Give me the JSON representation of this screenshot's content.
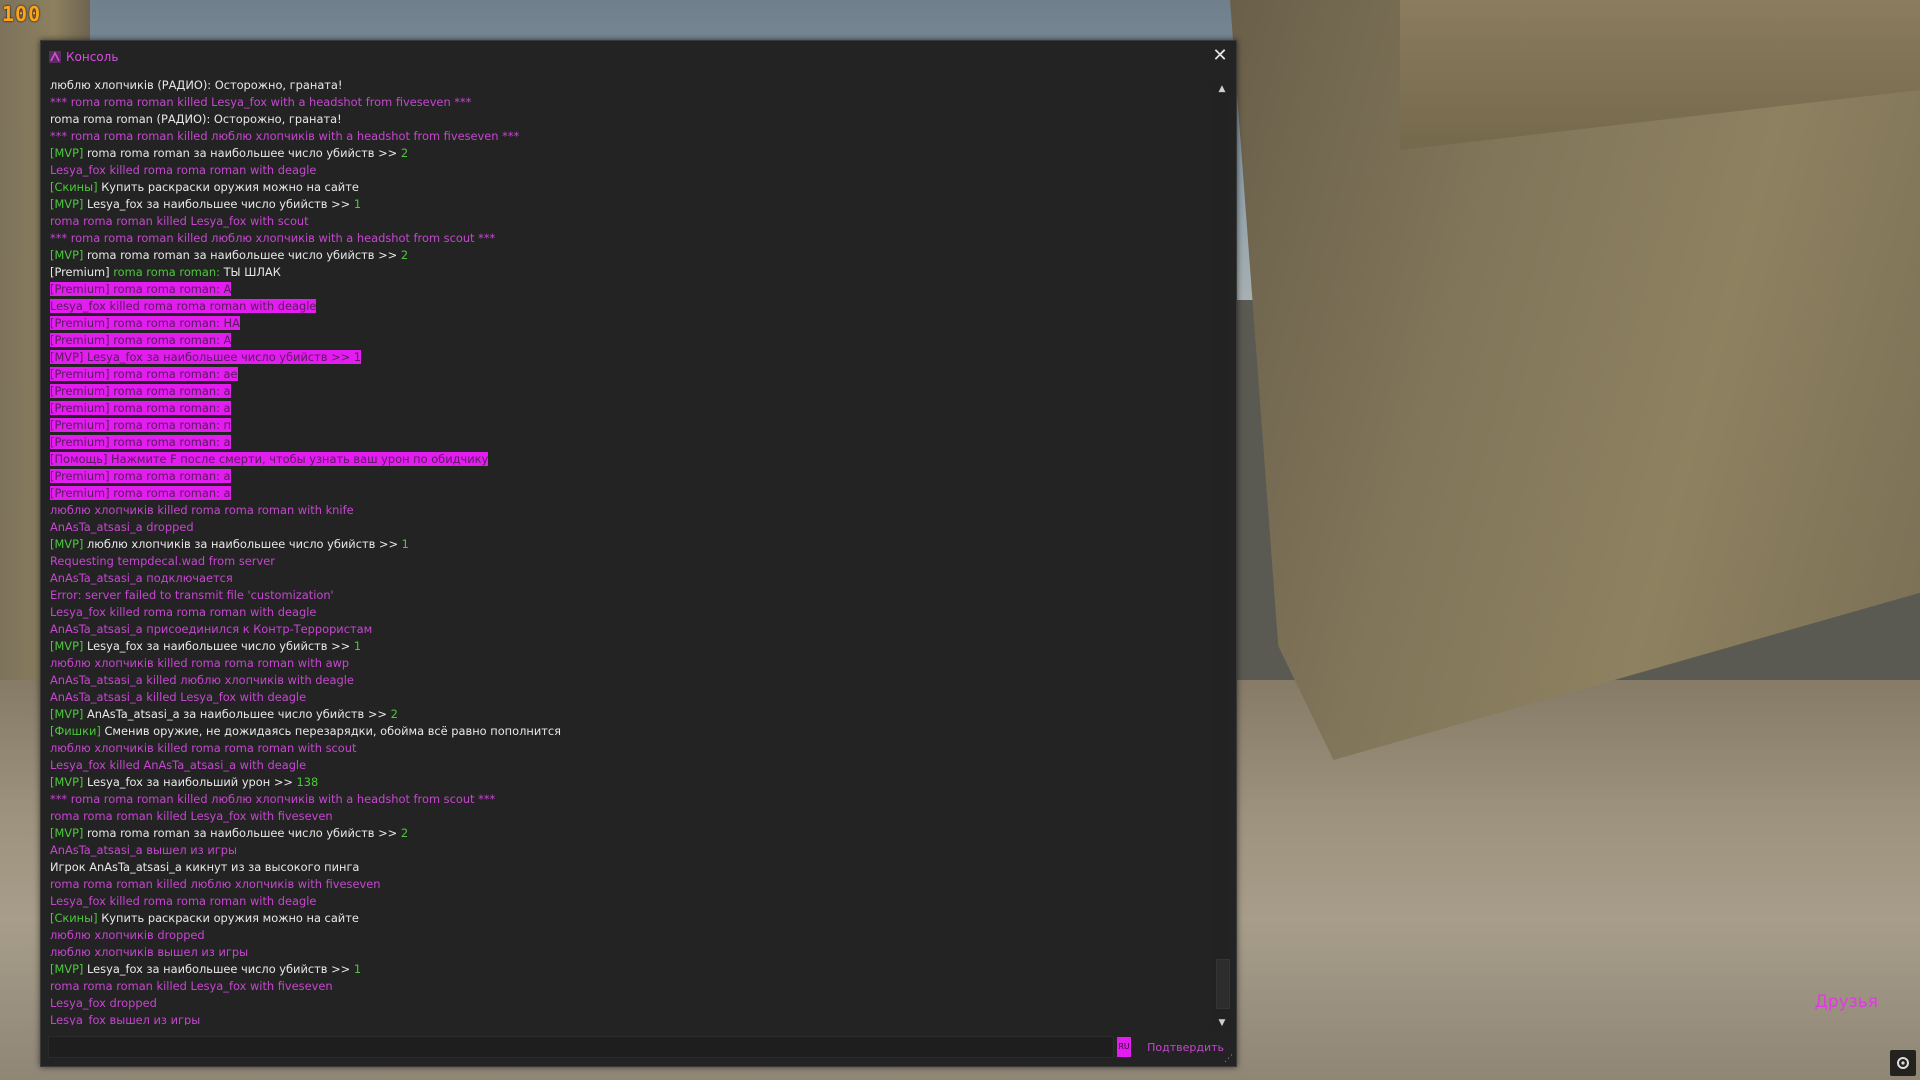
{
  "hud": {
    "health": "100",
    "friends_label": "Друзья"
  },
  "console": {
    "title": "Консоль",
    "confirm_label": "Подтвердить",
    "input_value": "",
    "lang_badge": "RU",
    "lines": [
      [
        [
          "c-white",
          "любл‍ю хлопчиків (РАДИО): Осторожно, граната!"
        ]
      ],
      [
        [
          "c-pink",
          "*** roma roma roman killed Lesya_fox with a headshot from fiveseven ***"
        ]
      ],
      [
        [
          "c-white",
          "roma roma roman (РАДИО): Осторожно, граната!"
        ]
      ],
      [
        [
          "c-pink",
          "*** roma roma roman killed любл‍ю хлопчиків with a headshot from fiveseven ***"
        ]
      ],
      [
        [
          "c-green",
          "[MVP] "
        ],
        [
          "c-white",
          "roma roma roman за наибольшее число убийств >> "
        ],
        [
          "c-green",
          "2"
        ]
      ],
      [
        [
          "c-pink",
          "Lesya_fox killed roma roma roman with deagle"
        ]
      ],
      [
        [
          "c-green",
          "[Скины] "
        ],
        [
          "c-white",
          "Купить раскраски оружия можно на сайте"
        ]
      ],
      [
        [
          "c-green",
          "[MVP] "
        ],
        [
          "c-white",
          "Lesya_fox за наибольшее число убийств >> "
        ],
        [
          "c-green",
          "1"
        ]
      ],
      [
        [
          "c-pink",
          "roma roma roman killed Lesya_fox with scout"
        ]
      ],
      [
        [
          "c-pink",
          "*** roma roma roman killed любл‍ю хлопчиків with a headshot from scout ***"
        ]
      ],
      [
        [
          "c-green",
          "[MVP] "
        ],
        [
          "c-white",
          "roma roma roman за наибольшее число убийств >> "
        ],
        [
          "c-green",
          "2"
        ]
      ],
      [
        [
          "c-white",
          "[Premium] "
        ],
        [
          "c-green",
          "roma roma roman: "
        ],
        [
          "c-white",
          "ТЫ ШЛАК"
        ]
      ],
      [
        [
          "hl",
          "[Premium] roma roma roman: A"
        ]
      ],
      [
        [
          "hl",
          "Lesya_fox killed roma roma roman with deagle"
        ]
      ],
      [
        [
          "hl",
          "[Premium] roma roma roman: НА"
        ]
      ],
      [
        [
          "hl",
          "[Premium] roma roma roman: A"
        ]
      ],
      [
        [
          "hl",
          "[MVP] Lesya_fox за наибольшее число убийств >> 1"
        ]
      ],
      [
        [
          "hl",
          "[Premium] roma roma roman: ae"
        ]
      ],
      [
        [
          "hl",
          "[Premium] roma roma roman: a"
        ]
      ],
      [
        [
          "hl",
          "[Premium] roma roma roman: a"
        ]
      ],
      [
        [
          "hl",
          "[Premium] roma roma roman: п"
        ]
      ],
      [
        [
          "hl",
          "[Premium] roma roma roman: a"
        ]
      ],
      [
        [
          "hl",
          "[Помощь] Нажмите F после смерти, чтобы узнать ваш урон по обидчику"
        ]
      ],
      [
        [
          "hl",
          "[Premium] roma roma roman: a"
        ]
      ],
      [
        [
          "hl",
          "[Premium] roma roma roman: a"
        ]
      ],
      [
        [
          "c-pink",
          "любл‍ю хлопчиків killed roma roma roman with knife"
        ]
      ],
      [
        [
          "c-pink",
          "AnAsTa_atsasi_a dropped"
        ]
      ],
      [
        [
          "c-green",
          "[MVP] "
        ],
        [
          "c-white",
          "любл‍ю хлопчиків за наибольшее число убийств >> "
        ],
        [
          "c-green",
          "1"
        ]
      ],
      [
        [
          "c-pink",
          "Requesting tempdecal.wad from server"
        ]
      ],
      [
        [
          "c-pink",
          "AnAsTa_atsasi_a подключается"
        ]
      ],
      [
        [
          "c-pink",
          "Error: server failed to transmit file 'customization'"
        ]
      ],
      [
        [
          "c-pink",
          "Lesya_fox killed roma roma roman with deagle"
        ]
      ],
      [
        [
          "c-pink",
          "AnAsTa_atsasi_a присоединился к Контр-Террористам"
        ]
      ],
      [
        [
          "c-green",
          "[MVP] "
        ],
        [
          "c-white",
          "Lesya_fox за наибольшее число убийств >> "
        ],
        [
          "c-green",
          "1"
        ]
      ],
      [
        [
          "c-pink",
          "любл‍ю хлопчиків killed roma roma roman with awp"
        ]
      ],
      [
        [
          "c-pink",
          "AnAsTa_atsasi_a killed любл‍ю хлопчиків with deagle"
        ]
      ],
      [
        [
          "c-pink",
          "AnAsTa_atsasi_a killed Lesya_fox with deagle"
        ]
      ],
      [
        [
          "c-green",
          "[MVP] "
        ],
        [
          "c-white",
          "AnAsTa_atsasi_a за наибольшее число убийств >> "
        ],
        [
          "c-green",
          "2"
        ]
      ],
      [
        [
          "c-green",
          "[Фишки] "
        ],
        [
          "c-white",
          "Сменив оружие, не дожидаясь перезарядки, обойма всё равно пополнится"
        ]
      ],
      [
        [
          "c-pink",
          "любл‍ю хлопчиків killed roma roma roman with scout"
        ]
      ],
      [
        [
          "c-pink",
          "Lesya_fox killed AnAsTa_atsasi_a with deagle"
        ]
      ],
      [
        [
          "c-green",
          "[MVP] "
        ],
        [
          "c-white",
          "Lesya_fox за наибольший урон >> "
        ],
        [
          "c-green",
          "138"
        ]
      ],
      [
        [
          "c-pink",
          "*** roma roma roman killed любл‍ю хлопчиків with a headshot from scout ***"
        ]
      ],
      [
        [
          "c-pink",
          "roma roma roman killed Lesya_fox with fiveseven"
        ]
      ],
      [
        [
          "c-green",
          "[MVP] "
        ],
        [
          "c-white",
          "roma roma roman за наибольшее число убийств >> "
        ],
        [
          "c-green",
          "2"
        ]
      ],
      [
        [
          "c-pink",
          "AnAsTa_atsasi_a вышел из игры"
        ]
      ],
      [
        [
          "c-white",
          "Игрок AnAsTa_atsasi_a кикнут из за высокого пинга"
        ]
      ],
      [
        [
          "c-pink",
          "roma roma roman killed любл‍ю хлопчиків with fiveseven"
        ]
      ],
      [
        [
          "c-pink",
          "Lesya_fox killed roma roma roman with deagle"
        ]
      ],
      [
        [
          "c-green",
          "[Скины] "
        ],
        [
          "c-white",
          "Купить раскраски оружия можно на сайте"
        ]
      ],
      [
        [
          "c-pink",
          "любл‍ю хлопчиків dropped"
        ]
      ],
      [
        [
          "c-pink",
          "любл‍ю хлопчиків вышел из игры"
        ]
      ],
      [
        [
          "c-green",
          "[MVP] "
        ],
        [
          "c-white",
          "Lesya_fox за наибольшее число убийств >> "
        ],
        [
          "c-green",
          "1"
        ]
      ],
      [
        [
          "c-pink",
          "roma roma roman killed Lesya_fox with fiveseven"
        ]
      ],
      [
        [
          "c-pink",
          "Lesya_fox dropped"
        ]
      ],
      [
        [
          "c-pink",
          "Lesya_fox вышел из игры"
        ]
      ]
    ]
  },
  "colors": {
    "pink": "#c646d0",
    "highlight": "#e31cef",
    "green": "#4cc83a",
    "white": "#e8e8e8",
    "hud_orange": "#ffa41a"
  },
  "icons": {
    "title": "console-app-icon",
    "close": "close-icon",
    "scroll_up": "chevron-up-icon",
    "scroll_down": "chevron-down-icon",
    "corner": "settings-icon",
    "grip": "resize-grip-icon"
  }
}
